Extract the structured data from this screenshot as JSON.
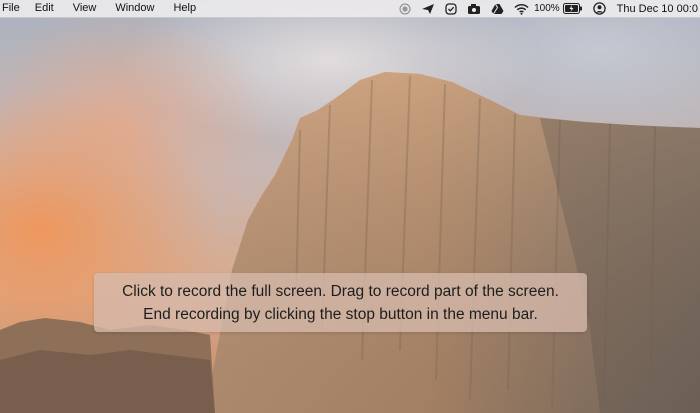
{
  "menubar": {
    "menus": [
      "File",
      "Edit",
      "View",
      "Window",
      "Help"
    ],
    "battery_percent": "100%",
    "datetime": "Thu Dec 10  00:0",
    "tray_icons": [
      "record-stop-icon",
      "paper-plane-icon",
      "check-circle-icon",
      "camera-icon",
      "drive-icon",
      "wifi-icon",
      "battery-icon",
      "user-icon"
    ]
  },
  "overlay": {
    "line1": "Click to record the full screen. Drag to record part of the screen.",
    "line2": "End recording by clicking the stop button in the menu bar."
  },
  "colors": {
    "menubar_bg": "#ece9ec",
    "overlay_bg": "#d6baac",
    "rock": "#b8906e"
  }
}
